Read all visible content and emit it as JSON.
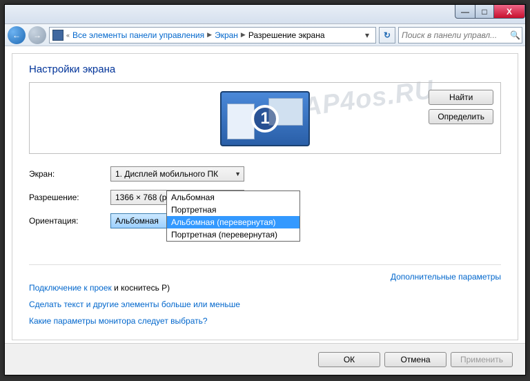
{
  "titlebar": {
    "minimize": "—",
    "maximize": "□",
    "close": "X"
  },
  "nav": {
    "back": "←",
    "forward": "→"
  },
  "breadcrumb": {
    "prefix": "«",
    "item1": "Все элементы панели управления",
    "item2": "Экран",
    "item3": "Разрешение экрана"
  },
  "refresh_icon": "↻",
  "search": {
    "placeholder": "Поиск в панели управл...",
    "icon": "🔍"
  },
  "page_title": "Настройки экрана",
  "monitor_number": "1",
  "buttons": {
    "find": "Найти",
    "detect": "Определить",
    "ok": "ОК",
    "cancel": "Отмена",
    "apply": "Применить"
  },
  "labels": {
    "screen": "Экран:",
    "resolution": "Разрешение:",
    "orientation": "Ориентация:"
  },
  "values": {
    "screen": "1. Дисплей мобильного ПК",
    "resolution": "1366 × 768 (рекомендуется)",
    "orientation": "Альбомная"
  },
  "orientation_options": [
    "Альбомная",
    "Портретная",
    "Альбомная (перевернутая)",
    "Портретная (перевернутая)"
  ],
  "orientation_selected_index": 2,
  "links": {
    "advanced": "Дополнительные параметры",
    "projector_pre": "Подключение к проек",
    "projector_post": " и коснитесь P)",
    "text_size": "Сделать текст и другие элементы больше или меньше",
    "which_monitor": "Какие параметры монитора следует выбрать?"
  },
  "watermark": "AP4os.RU"
}
